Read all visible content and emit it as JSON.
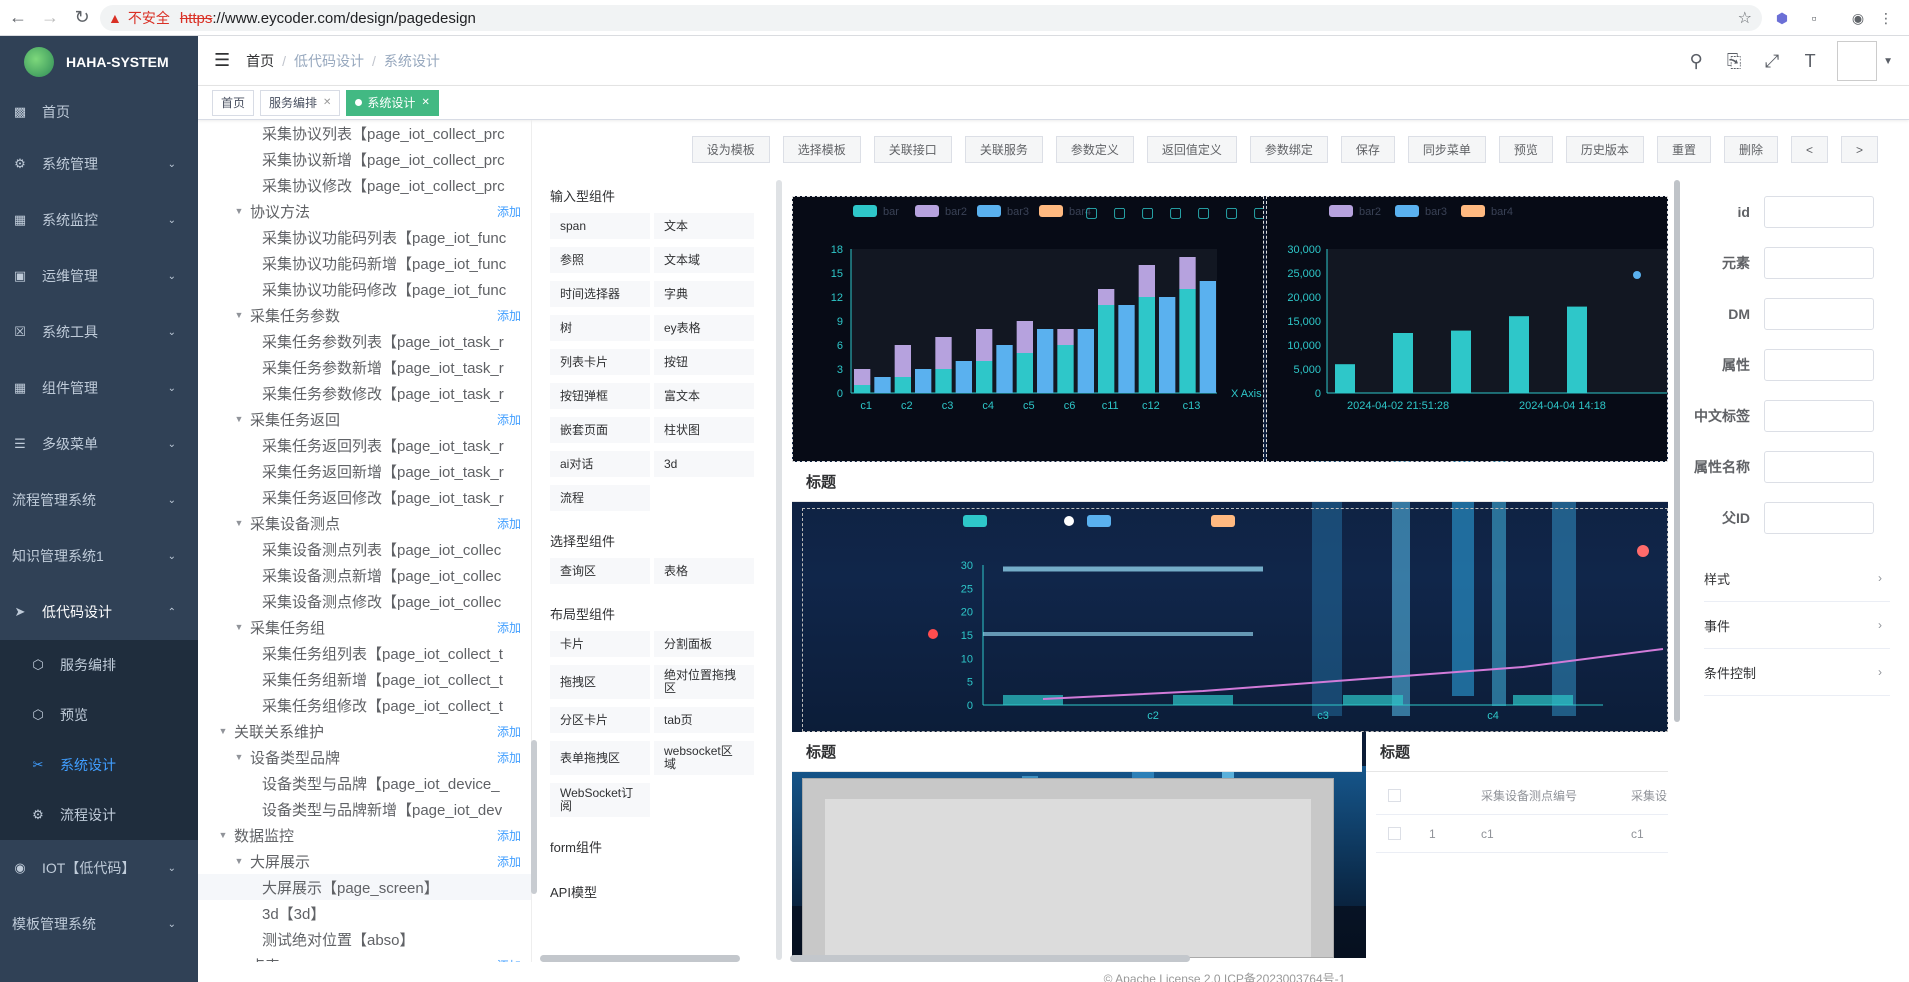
{
  "browser": {
    "insecure_label": "不安全",
    "url_scheme": "https",
    "url_rest": "://www.eycoder.com/design/pagedesign"
  },
  "app": {
    "name": "HAHA-SYSTEM"
  },
  "sidebar": {
    "items": [
      {
        "label": "首页",
        "icon": "dashboard-icon"
      },
      {
        "label": "系统管理",
        "icon": "gear-icon"
      },
      {
        "label": "系统监控",
        "icon": "monitor-icon"
      },
      {
        "label": "运维管理",
        "icon": "ops-icon"
      },
      {
        "label": "系统工具",
        "icon": "tool-icon"
      },
      {
        "label": "组件管理",
        "icon": "grid-icon"
      },
      {
        "label": "多级菜单",
        "icon": "list-icon"
      },
      {
        "label": "流程管理系统"
      },
      {
        "label": "知识管理系统1"
      },
      {
        "label": "低代码设计",
        "icon": "send-icon"
      }
    ],
    "sub": [
      {
        "label": "服务编排",
        "icon": "cube-icon"
      },
      {
        "label": "预览",
        "icon": "cube-icon"
      },
      {
        "label": "系统设计",
        "icon": "scissors-icon"
      },
      {
        "label": "流程设计",
        "icon": "flow-icon"
      }
    ],
    "after": [
      {
        "label": "IOT【低代码】",
        "icon": "globe-icon"
      },
      {
        "label": "模板管理系统"
      }
    ]
  },
  "breadcrumb": [
    "首页",
    "低代码设计",
    "系统设计"
  ],
  "tags": [
    {
      "label": "首页"
    },
    {
      "label": "服务编排"
    },
    {
      "label": "系统设计"
    }
  ],
  "tree": {
    "add": "添加",
    "nodes": [
      {
        "label": "采集协议列表【page_iot_collect_prc",
        "level": 3
      },
      {
        "label": "采集协议新增【page_iot_collect_prc",
        "level": 3
      },
      {
        "label": "采集协议修改【page_iot_collect_prc",
        "level": 3
      },
      {
        "label": "协议方法",
        "level": 2,
        "expand": true,
        "add": true
      },
      {
        "label": "采集协议功能码列表【page_iot_func",
        "level": 3
      },
      {
        "label": "采集协议功能码新增【page_iot_func",
        "level": 3
      },
      {
        "label": "采集协议功能码修改【page_iot_func",
        "level": 3
      },
      {
        "label": "采集任务参数",
        "level": 2,
        "expand": true,
        "add": true
      },
      {
        "label": "采集任务参数列表【page_iot_task_r",
        "level": 3
      },
      {
        "label": "采集任务参数新增【page_iot_task_r",
        "level": 3
      },
      {
        "label": "采集任务参数修改【page_iot_task_r",
        "level": 3
      },
      {
        "label": "采集任务返回",
        "level": 2,
        "expand": true,
        "add": true
      },
      {
        "label": "采集任务返回列表【page_iot_task_r",
        "level": 3
      },
      {
        "label": "采集任务返回新增【page_iot_task_r",
        "level": 3
      },
      {
        "label": "采集任务返回修改【page_iot_task_r",
        "level": 3
      },
      {
        "label": "采集设备测点",
        "level": 2,
        "expand": true,
        "add": true
      },
      {
        "label": "采集设备测点列表【page_iot_collec",
        "level": 3
      },
      {
        "label": "采集设备测点新增【page_iot_collec",
        "level": 3
      },
      {
        "label": "采集设备测点修改【page_iot_collec",
        "level": 3
      },
      {
        "label": "采集任务组",
        "level": 2,
        "expand": true,
        "add": true
      },
      {
        "label": "采集任务组列表【page_iot_collect_t",
        "level": 3
      },
      {
        "label": "采集任务组新增【page_iot_collect_t",
        "level": 3
      },
      {
        "label": "采集任务组修改【page_iot_collect_t",
        "level": 3
      },
      {
        "label": "关联关系维护",
        "level": 1,
        "expand": true,
        "add": true
      },
      {
        "label": "设备类型品牌",
        "level": 2,
        "expand": true,
        "add": true
      },
      {
        "label": "设备类型与品牌【page_iot_device_",
        "level": 3
      },
      {
        "label": "设备类型与品牌新增【page_iot_dev",
        "level": 3
      },
      {
        "label": "数据监控",
        "level": 1,
        "expand": true,
        "add": true
      },
      {
        "label": "大屏展示",
        "level": 2,
        "expand": true,
        "add": true
      },
      {
        "label": "大屏展示【page_screen】",
        "level": 3,
        "hl": true
      },
      {
        "label": "3d【3d】",
        "level": 3
      },
      {
        "label": "测试绝对位置【abso】",
        "level": 3
      },
      {
        "label": "点表",
        "level": 2,
        "expand": true,
        "add": true
      }
    ]
  },
  "components": {
    "groups": [
      {
        "title": "输入型组件",
        "items": [
          "span",
          "文本",
          "参照",
          "文本域",
          "时间选择器",
          "字典",
          "树",
          "ey表格",
          "列表卡片",
          "按钮",
          "按钮弹框",
          "富文本",
          "嵌套页面",
          "柱状图",
          "ai对话",
          "3d",
          "流程"
        ]
      },
      {
        "title": "选择型组件",
        "items": [
          "查询区",
          "表格"
        ]
      },
      {
        "title": "布局型组件",
        "items": [
          "卡片",
          "分割面板",
          "拖拽区",
          "绝对位置拖拽区",
          "分区卡片",
          "tab页",
          "表单拖拽区",
          "websocket区域",
          "WebSocket订阅"
        ]
      },
      {
        "title": "form组件",
        "items": []
      },
      {
        "title": "API模型",
        "items": []
      }
    ]
  },
  "toolbar": [
    "设为模板",
    "选择模板",
    "关联接口",
    "关联服务",
    "参数定义",
    "返回值定义",
    "参数绑定",
    "保存",
    "同步菜单",
    "预览",
    "历史版本",
    "重置",
    "删除",
    "<",
    ">"
  ],
  "canvas": {
    "panel_titles": [
      "标题",
      "标题",
      "标题"
    ],
    "table_headers": [
      "采集设备测点编号",
      "采集设"
    ],
    "table_row": [
      "1",
      "c1",
      "c1"
    ]
  },
  "properties": {
    "fields": [
      "id",
      "元素",
      "DM",
      "属性",
      "中文标签",
      "属性名称",
      "父ID"
    ],
    "sections": [
      "样式",
      "事件",
      "条件控制"
    ]
  },
  "footer": "© Apache License 2.0    ICP备2023003764号-1",
  "chart_data": [
    {
      "type": "bar",
      "legend": [
        "bar",
        "bar2",
        "bar3",
        "bar4"
      ],
      "categories": [
        "c1",
        "c2",
        "c3",
        "c4",
        "c5",
        "c6",
        "c11",
        "c12",
        "c13"
      ],
      "xlabel": "X Axis",
      "ylim": [
        0,
        18
      ],
      "yticks": [
        0,
        3,
        6,
        9,
        12,
        15,
        18
      ],
      "series": [
        {
          "name": "bar",
          "values": [
            1,
            2,
            3,
            4,
            5,
            6,
            11,
            12,
            13
          ]
        },
        {
          "name": "bar2",
          "values": [
            2,
            4,
            4,
            4,
            4,
            2,
            2,
            4,
            4
          ]
        },
        {
          "name": "bar3",
          "values": [
            2,
            3,
            4,
            6,
            8,
            8,
            11,
            12,
            14
          ]
        }
      ],
      "colors": {
        "bar": "#2ec7c9",
        "bar2": "#b6a2de",
        "bar3": "#5ab1ef",
        "bar4": "#ffb980"
      }
    },
    {
      "type": "bar",
      "legend": [
        "bar2",
        "bar3",
        "bar4"
      ],
      "x_labels": [
        "2024-04-02 21:51:28",
        "2024-04-04 14:18"
      ],
      "yticks": [
        0,
        5000,
        10000,
        15000,
        20000,
        25000,
        30000
      ],
      "ylim": [
        0,
        30000
      ],
      "values": [
        6000,
        12500,
        13000,
        16000,
        18000
      ]
    },
    {
      "type": "bar",
      "legend": [
        "",
        "",
        ""
      ],
      "categories": [
        "c2",
        "c3",
        "c4"
      ],
      "yticks": [
        0,
        5,
        10,
        15,
        20,
        25,
        30
      ],
      "ylim": [
        0,
        30
      ]
    }
  ]
}
